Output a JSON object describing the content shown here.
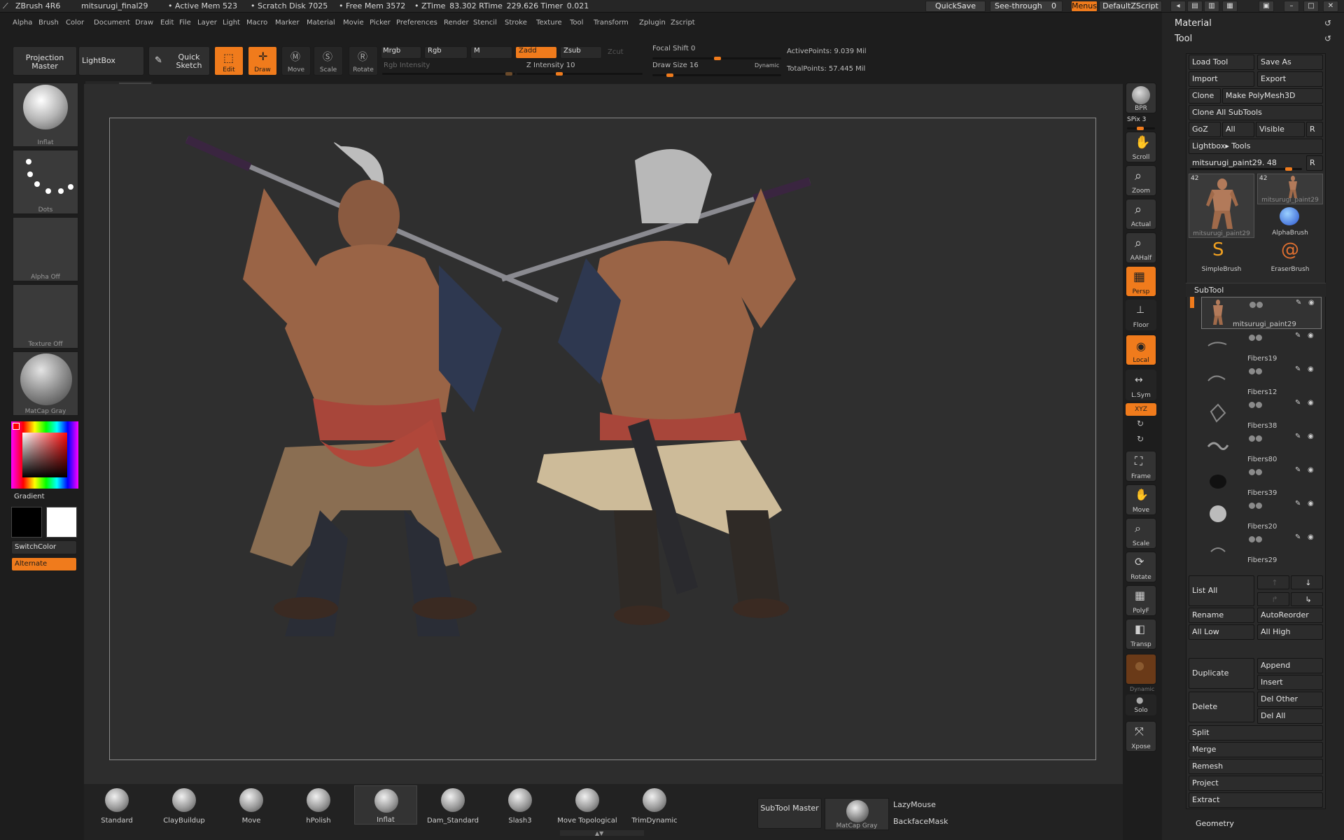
{
  "titlebar": {
    "app": "ZBrush 4R6",
    "file": "mitsurugi_final29",
    "active_mem": "• Active Mem 523",
    "scratch": "• Scratch Disk 7025",
    "free_mem": "• Free Mem 3572",
    "ztime": "• ZTime  83.302 RTime  229.626 Timer  0.021",
    "quicksave": "QuickSave",
    "see_through": "See-through",
    "see_through_val": "0",
    "menus": "Menus",
    "script": "DefaultZScript"
  },
  "menubar": [
    "Alpha",
    "Brush",
    "Color",
    "Document",
    "Draw",
    "Edit",
    "File",
    "Layer",
    "Light",
    "Macro",
    "Marker",
    "Material",
    "Movie",
    "Picker",
    "Preferences",
    "Render",
    "Stencil",
    "Stroke",
    "Texture",
    "Tool",
    "Transform",
    "Zplugin",
    "Zscript"
  ],
  "shelf": {
    "projection_master": "Projection Master",
    "lightbox": "LightBox",
    "quick_sketch": "Quick Sketch",
    "edit": "Edit",
    "draw": "Draw",
    "move": "Move",
    "scale": "Scale",
    "rotate": "Rotate",
    "mrgb": "Mrgb",
    "rgb": "Rgb",
    "m": "M",
    "rgb_intensity": "Rgb Intensity",
    "zadd": "Zadd",
    "zsub": "Zsub",
    "zcut": "Zcut",
    "z_intensity": "Z Intensity 10",
    "focal_shift": "Focal Shift 0",
    "draw_size": "Draw Size 16",
    "dynamic": "Dynamic",
    "active_points": "ActivePoints: 9.039  Mil",
    "total_points": "TotalPoints: 57.445  Mil"
  },
  "left_tray": {
    "brush_label": "Inflat",
    "stroke_label": "Dots",
    "alpha_label": "Alpha  Off",
    "texture_label": "Texture  Off",
    "material_label": "MatCap  Gray",
    "gradient": "Gradient",
    "switch_color": "SwitchColor",
    "alternate": "Alternate"
  },
  "right_tray": [
    "BPR",
    "SPix 3",
    "Scroll",
    "Zoom",
    "Actual",
    "AAHalf",
    "Persp",
    "Floor",
    "Local",
    "L.Sym",
    "XYZ",
    "Frame",
    "Move",
    "Scale",
    "Rotate",
    "PolyF",
    "Transp",
    "Dynamic",
    "Solo",
    "Xpose"
  ],
  "right_panel": {
    "material": "Material",
    "tool": "Tool",
    "load_tool": "Load Tool",
    "save_as": "Save As",
    "import": "Import",
    "export": "Export",
    "clone": "Clone",
    "make_polymesh": "Make PolyMesh3D",
    "clone_all": "Clone  All  SubTools",
    "goz": "GoZ",
    "all": "All",
    "visible": "Visible",
    "r": "R",
    "lightbox_tools": "Lightbox▸ Tools",
    "current_tool": "mitsurugi_paint29. 48",
    "tool_count_1": "42",
    "tool_count_2": "42",
    "thumb_1": "mitsurugi_paint29",
    "thumb_2": "mitsurugi_paint29",
    "alpha_brush": "AlphaBrush",
    "simple_brush": "SimpleBrush",
    "eraser_brush": "EraserBrush",
    "subtool_title": "SubTool",
    "subtools": [
      "mitsurugi_paint29",
      "Fibers19",
      "Fibers12",
      "Fibers38",
      "Fibers80",
      "Fibers39",
      "Fibers20",
      "Fibers29"
    ],
    "list_all": "List  All",
    "rename": "Rename",
    "auto_reorder": "AutoReorder",
    "all_low": "All  Low",
    "all_high": "All  High",
    "duplicate": "Duplicate",
    "append": "Append",
    "insert": "Insert",
    "delete": "Delete",
    "del_other": "Del Other",
    "del_all": "Del All",
    "split": "Split",
    "merge": "Merge",
    "remesh": "Remesh",
    "project": "Project",
    "extract": "Extract",
    "geometry": "Geometry"
  },
  "bottom_shelf": {
    "brushes": [
      "Standard",
      "ClayBuildup",
      "Move",
      "hPolish",
      "Inflat",
      "Dam_Standard",
      "Slash3",
      "Move  Topological",
      "TrimDynamic"
    ],
    "subtool_master": "SubTool Master",
    "matcap": "MatCap  Gray",
    "lazymouse": "LazyMouse",
    "backfacemask": "BackfaceMask"
  }
}
